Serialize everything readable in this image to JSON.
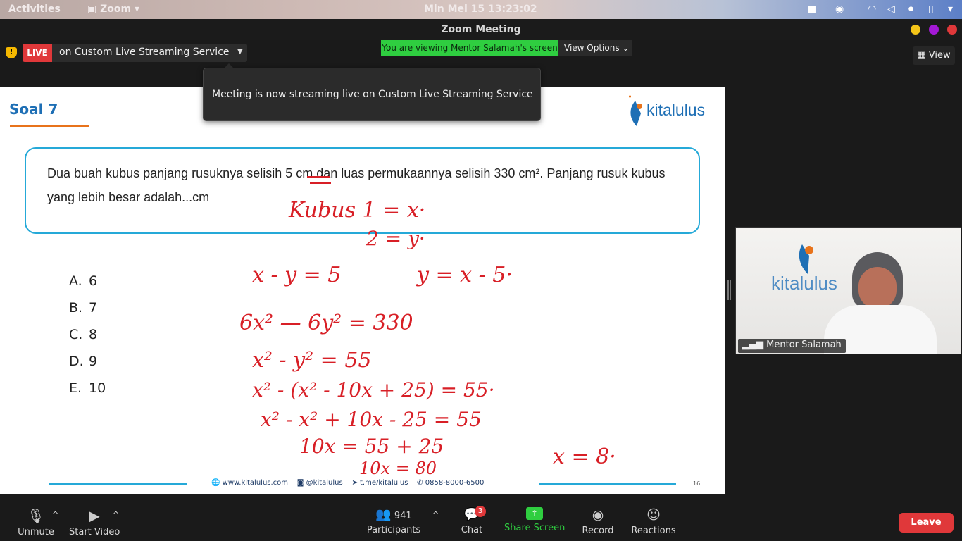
{
  "desktop": {
    "activities": "Activities",
    "app": "Zoom",
    "clock": "Min Mei 15  13:23:02"
  },
  "window": {
    "title": "Zoom Meeting"
  },
  "live": {
    "badge": "LIVE",
    "service": "on Custom Live Streaming Service"
  },
  "share": {
    "banner": "You are viewing Mentor Salamah's screen",
    "view_options": "View Options",
    "view": "View"
  },
  "toast": {
    "text": "Meeting is now streaming live on Custom Live Streaming Service"
  },
  "slide": {
    "title": "Soal 7",
    "brand": "kitalulus",
    "question": "Dua buah kubus panjang rusuknya selisih 5 cm dan luas permukaannya selisih 330 cm². Panjang rusuk kubus yang lebih besar adalah...cm",
    "options": [
      {
        "letter": "A.",
        "value": "6"
      },
      {
        "letter": "B.",
        "value": "7"
      },
      {
        "letter": "C.",
        "value": "8"
      },
      {
        "letter": "D.",
        "value": "9"
      },
      {
        "letter": "E.",
        "value": "10"
      }
    ],
    "footer": {
      "web": "www.kitalulus.com",
      "ig": "@kitalulus",
      "tg": "t.me/kitalulus",
      "wa": "0858-8000-6500",
      "page": "16"
    },
    "handwriting": [
      "Kubus  1 = x·",
      "2 = y·",
      "x - y = 5",
      "y = x - 5·",
      "6x² — 6y² = 330",
      "x² - y² = 55",
      "x² - (x² - 10x + 25) = 55·",
      "x² - x² + 10x - 25 = 55",
      "10x = 55 + 25",
      "10x = 80",
      "x = 8·"
    ]
  },
  "video": {
    "name": "Mentor Salamah",
    "logo": "kitalulus"
  },
  "toolbar": {
    "unmute": "Unmute",
    "start_video": "Start Video",
    "participants": "Participants",
    "participants_count": "941",
    "chat": "Chat",
    "chat_badge": "3",
    "share": "Share Screen",
    "record": "Record",
    "reactions": "Reactions",
    "leave": "Leave"
  },
  "colors": {
    "accent_blue": "#1e6fb5",
    "brand_orange": "#e8731b",
    "live_red": "#e0383a",
    "share_green": "#2fce40",
    "ink_red": "#d81f26",
    "leave_red": "#e0383a"
  }
}
